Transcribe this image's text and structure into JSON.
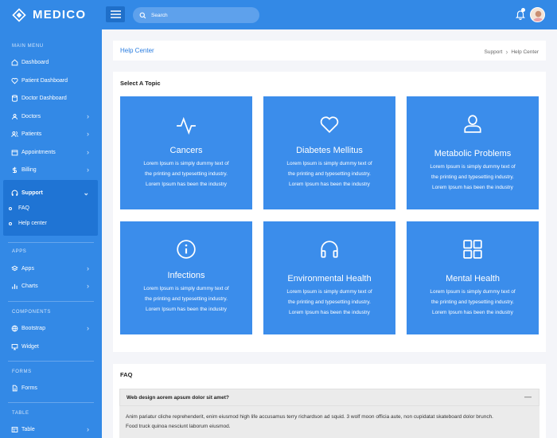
{
  "brand": {
    "name": "MEDICO"
  },
  "colors": {
    "primary": "#3389e6",
    "tile": "#3b8deb",
    "active_sub": "#1f74d4",
    "link": "#2a7de0"
  },
  "sidebar": {
    "main_menu_label": "MAIN MENU",
    "items": [
      {
        "label": "Dashboard",
        "icon": "home-icon"
      },
      {
        "label": "Patient Dashboard",
        "icon": "heart-icon"
      },
      {
        "label": "Doctor Dashboard",
        "icon": "database-icon"
      },
      {
        "label": "Doctors",
        "icon": "user-icon"
      },
      {
        "label": "Patients",
        "icon": "users-icon"
      },
      {
        "label": "Appointments",
        "icon": "calendar-icon"
      },
      {
        "label": "Billing",
        "icon": "dollar-icon"
      },
      {
        "label": "Support",
        "icon": "headphones-icon"
      }
    ],
    "support_sub": [
      "FAQ",
      "Help center"
    ],
    "apps_label": "APPS",
    "apps_items": [
      {
        "label": "Apps",
        "icon": "layers-icon"
      },
      {
        "label": "Charts",
        "icon": "bar-chart-icon"
      }
    ],
    "components_label": "COMPONENTS",
    "components_items": [
      {
        "label": "Bootstrap",
        "icon": "globe-icon"
      },
      {
        "label": "Widget",
        "icon": "monitor-icon"
      }
    ],
    "forms_label": "FORMS",
    "forms_items": [
      {
        "label": "Forms",
        "icon": "file-icon"
      }
    ],
    "table_label": "TABLE",
    "table_items": [
      {
        "label": "Table",
        "icon": "table-icon"
      }
    ]
  },
  "topbar": {
    "search_placeholder": "Search"
  },
  "header": {
    "title": "Help Center",
    "crumb_parent": "Support",
    "crumb_current": "Help Center"
  },
  "topics": {
    "heading": "Select A Topic",
    "tiles": [
      {
        "title": "Cancers",
        "icon": "activity-icon",
        "line1": "Lorem Ipsum is simply dummy text of",
        "line2": "the printing and typesetting industry.",
        "line3": "Lorem Ipsum has been the industry"
      },
      {
        "title": "Diabetes Mellitus",
        "icon": "heart-icon",
        "line1": "Lorem Ipsum is simply dummy text of",
        "line2": "the printing and typesetting industry.",
        "line3": "Lorem Ipsum has been the industry"
      },
      {
        "title": "Metabolic Problems",
        "icon": "user-icon",
        "line1": "Lorem Ipsum is simply dummy text of",
        "line2": "the printing and typesetting industry.",
        "line3": "Lorem Ipsum has been the industry"
      },
      {
        "title": "Infections",
        "icon": "info-icon",
        "line1": "Lorem Ipsum is simply dummy text of",
        "line2": "the printing and typesetting industry.",
        "line3": "Lorem Ipsum has been the industry"
      },
      {
        "title": "Environmental Health",
        "icon": "headphones-icon",
        "line1": "Lorem Ipsum is simply dummy text of",
        "line2": "the printing and typesetting industry.",
        "line3": "Lorem Ipsum has been the industry"
      },
      {
        "title": "Mental Health",
        "icon": "grid-icon",
        "line1": "Lorem Ipsum is simply dummy text of",
        "line2": "the printing and typesetting industry.",
        "line3": "Lorem Ipsum has been the industry"
      }
    ]
  },
  "faq": {
    "heading": "FAQ",
    "question": "Web design aorem apsum dolor sit amet?",
    "toggle": "—",
    "answer_line1": "Anim pariatur cliche reprehenderit, enim eiusmod high life accusamus terry richardson ad squid. 3 wolf moon officia aute, non cupidatat skateboard dolor brunch.",
    "answer_line2": "Food truck quinoa nesciunt laborum eiusmod."
  }
}
